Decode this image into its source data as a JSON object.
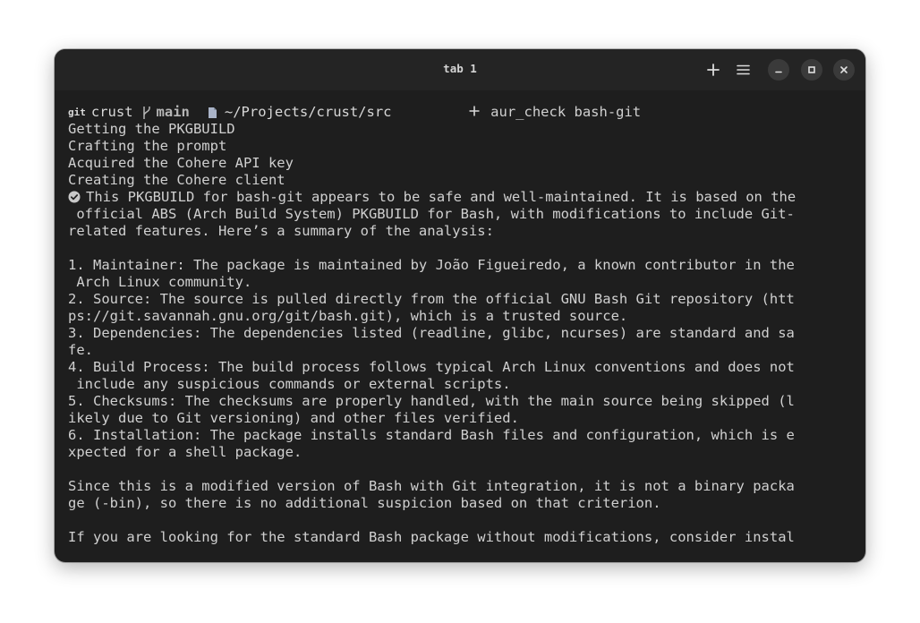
{
  "window": {
    "title": "tab 1"
  },
  "prompt": {
    "vcs": "git",
    "repo": "crust",
    "branch": "main",
    "path": "~/Projects/crust/src",
    "command": "aur_check bash-git"
  },
  "output": [
    "Getting the PKGBUILD",
    "Crafting the prompt",
    "Acquired the Cohere API key",
    "Creating the Cohere client",
    "This PKGBUILD for bash-git appears to be safe and well-maintained. It is based on the",
    " official ABS (Arch Build System) PKGBUILD for Bash, with modifications to include Git-",
    "related features. Here’s a summary of the analysis:",
    "",
    "1. Maintainer: The package is maintained by João Figueiredo, a known contributor in the",
    " Arch Linux community.",
    "2. Source: The source is pulled directly from the official GNU Bash Git repository (htt",
    "ps://git.savannah.gnu.org/git/bash.git), which is a trusted source.",
    "3. Dependencies: The dependencies listed (readline, glibc, ncurses) are standard and sa",
    "fe.",
    "4. Build Process: The build process follows typical Arch Linux conventions and does not",
    " include any suspicious commands or external scripts.",
    "5. Checksums: The checksums are properly handled, with the main source being skipped (l",
    "ikely due to Git versioning) and other files verified.",
    "6. Installation: The package installs standard Bash files and configuration, which is e",
    "xpected for a shell package.",
    "",
    "Since this is a modified version of Bash with Git integration, it is not a binary packa",
    "ge (-bin), so there is no additional suspicion based on that criterion.",
    "",
    "If you are looking for the standard Bash package without modifications, consider instal"
  ],
  "colors": {
    "background": "#1e1e1e",
    "titlebar": "#242424",
    "text": "#d0d0d0"
  }
}
